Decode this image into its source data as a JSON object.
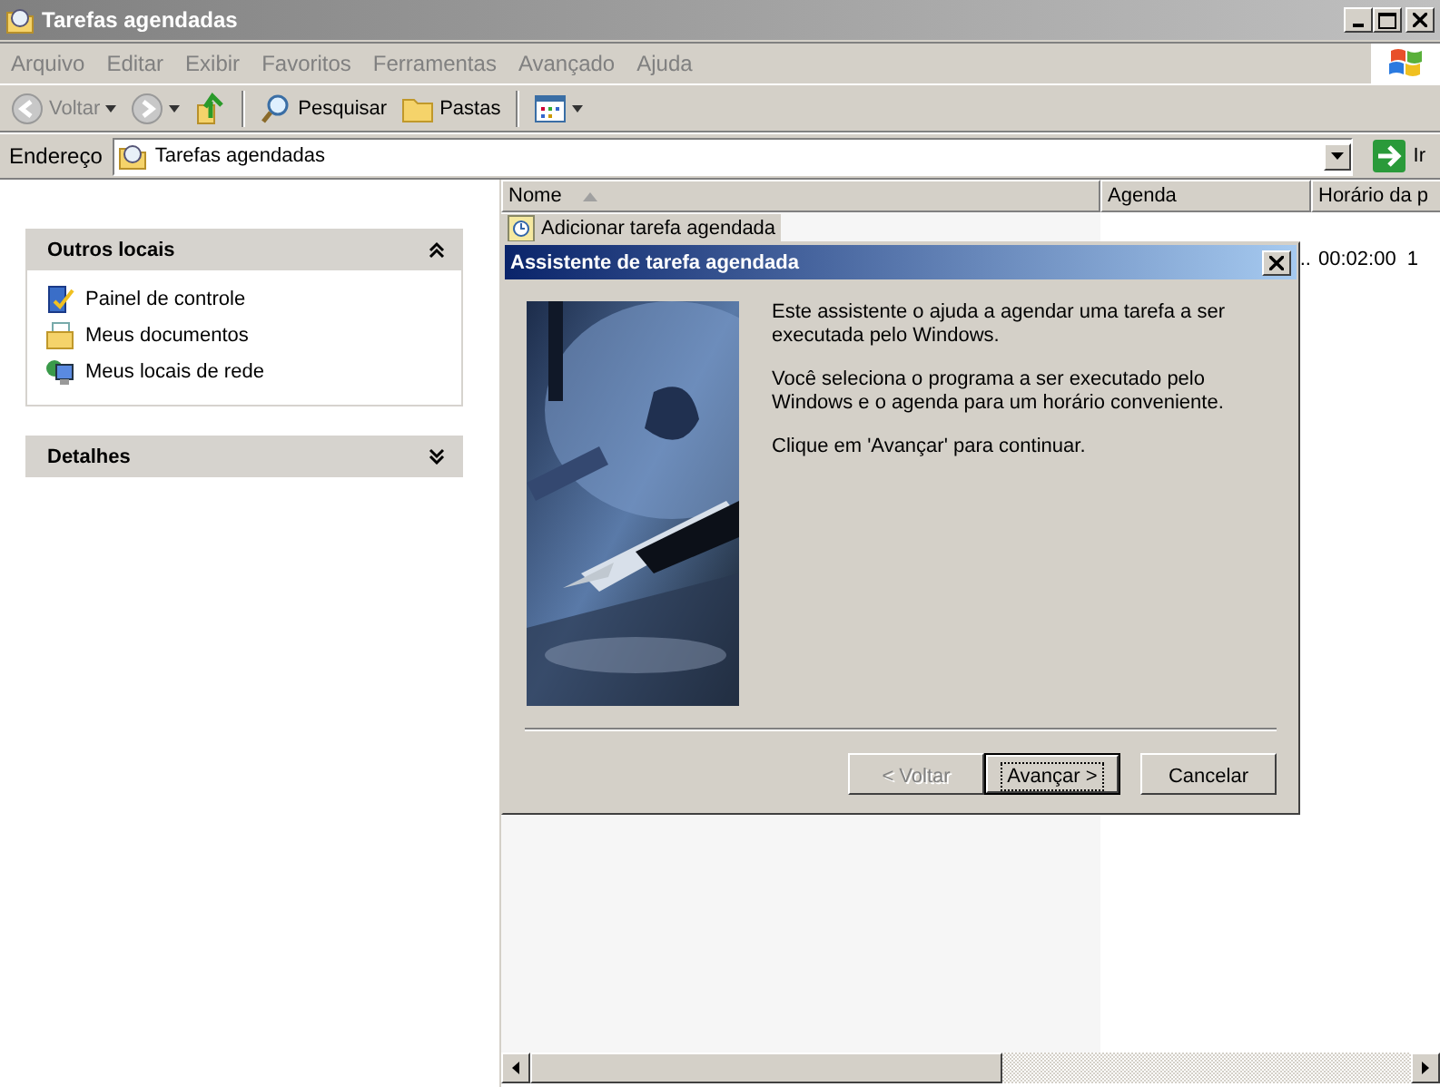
{
  "window": {
    "title": "Tarefas agendadas",
    "active": false
  },
  "menu": [
    {
      "label": "Arquivo"
    },
    {
      "label": "Editar"
    },
    {
      "label": "Exibir"
    },
    {
      "label": "Favoritos"
    },
    {
      "label": "Ferramentas"
    },
    {
      "label": "Avançado"
    },
    {
      "label": "Ajuda"
    }
  ],
  "toolbar": [
    {
      "kind": "back",
      "label": "Voltar",
      "disabled": true
    },
    {
      "kind": "forward",
      "disabled": true
    },
    {
      "kind": "up"
    },
    {
      "kind": "sep"
    },
    {
      "kind": "search",
      "label": "Pesquisar"
    },
    {
      "kind": "folders",
      "label": "Pastas"
    },
    {
      "kind": "sep"
    },
    {
      "kind": "views"
    }
  ],
  "address": {
    "label": "Endereço",
    "value": "Tarefas agendadas",
    "go": "Ir"
  },
  "sidebar": [
    {
      "title": "Outros locais",
      "expanded": true,
      "items": [
        {
          "label": "Painel de controle"
        },
        {
          "label": "Meus documentos"
        },
        {
          "label": "Meus locais de rede"
        }
      ]
    },
    {
      "title": "Detalhes",
      "expanded": false
    }
  ],
  "table": {
    "columns": [
      {
        "label": "Nome",
        "sorted": true
      },
      {
        "label": "Agenda"
      },
      {
        "label": "Horário da p"
      }
    ],
    "rows": [
      {
        "name": "Adicionar tarefa agendada",
        "selected": true
      },
      {
        "agenda": "..",
        "time": "00:02:00",
        "column_4": "1"
      }
    ]
  },
  "dialog": {
    "title": "Assistente de tarefa agendada",
    "paragraphs": [
      "Este assistente o ajuda a agendar uma tarefa a ser executada pelo Windows.",
      "Você seleciona o programa a ser executado pelo Windows e o agenda para um horário conveniente.",
      "Clique em 'Avançar' para continuar."
    ],
    "buttons": [
      {
        "label": "< Voltar",
        "disabled": true,
        "default": false
      },
      {
        "label": "Avançar >",
        "disabled": false,
        "default": true
      },
      {
        "label": "Cancelar",
        "disabled": false,
        "default": false
      }
    ]
  }
}
